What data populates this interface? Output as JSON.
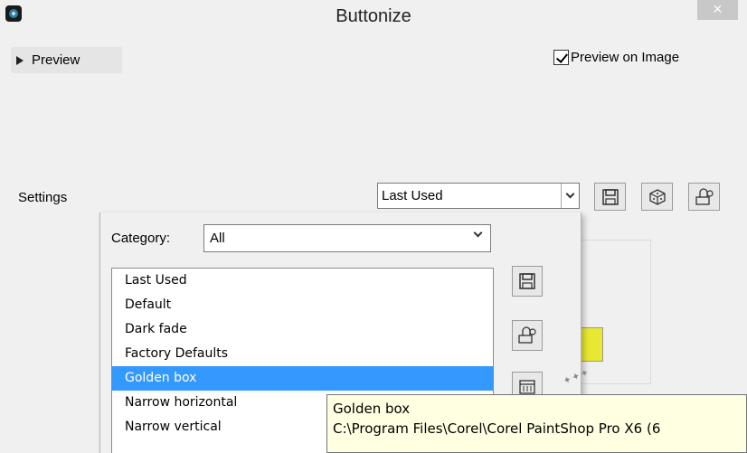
{
  "window": {
    "title": "Buttonize",
    "close_symbol": "×"
  },
  "preview": {
    "toggle_label": "Preview",
    "preview_on_image_label": "Preview on Image",
    "preview_on_image_checked": true
  },
  "settings": {
    "label": "Settings",
    "selected_preset": "Last Used"
  },
  "category": {
    "label": "Category:",
    "selected": "All"
  },
  "presets": [
    "Last Used",
    "Default",
    "Dark fade",
    "Factory Defaults",
    "Golden box",
    "Narrow horizontal",
    "Narrow vertical"
  ],
  "selected_preset_index": 4,
  "tooltip": {
    "title": "Golden box",
    "path": "C:\\Program Files\\Corel\\Corel PaintShop Pro X6 (6"
  },
  "colors": {
    "selection": "#3399ff",
    "tooltip_bg": "#ffffe1",
    "swatch": "#e8e832"
  },
  "icons": {
    "toolbar": [
      "save-icon",
      "randomize-icon",
      "manage-presets-icon"
    ],
    "side": [
      "save-icon",
      "manage-presets-icon",
      "delete-icon"
    ]
  }
}
